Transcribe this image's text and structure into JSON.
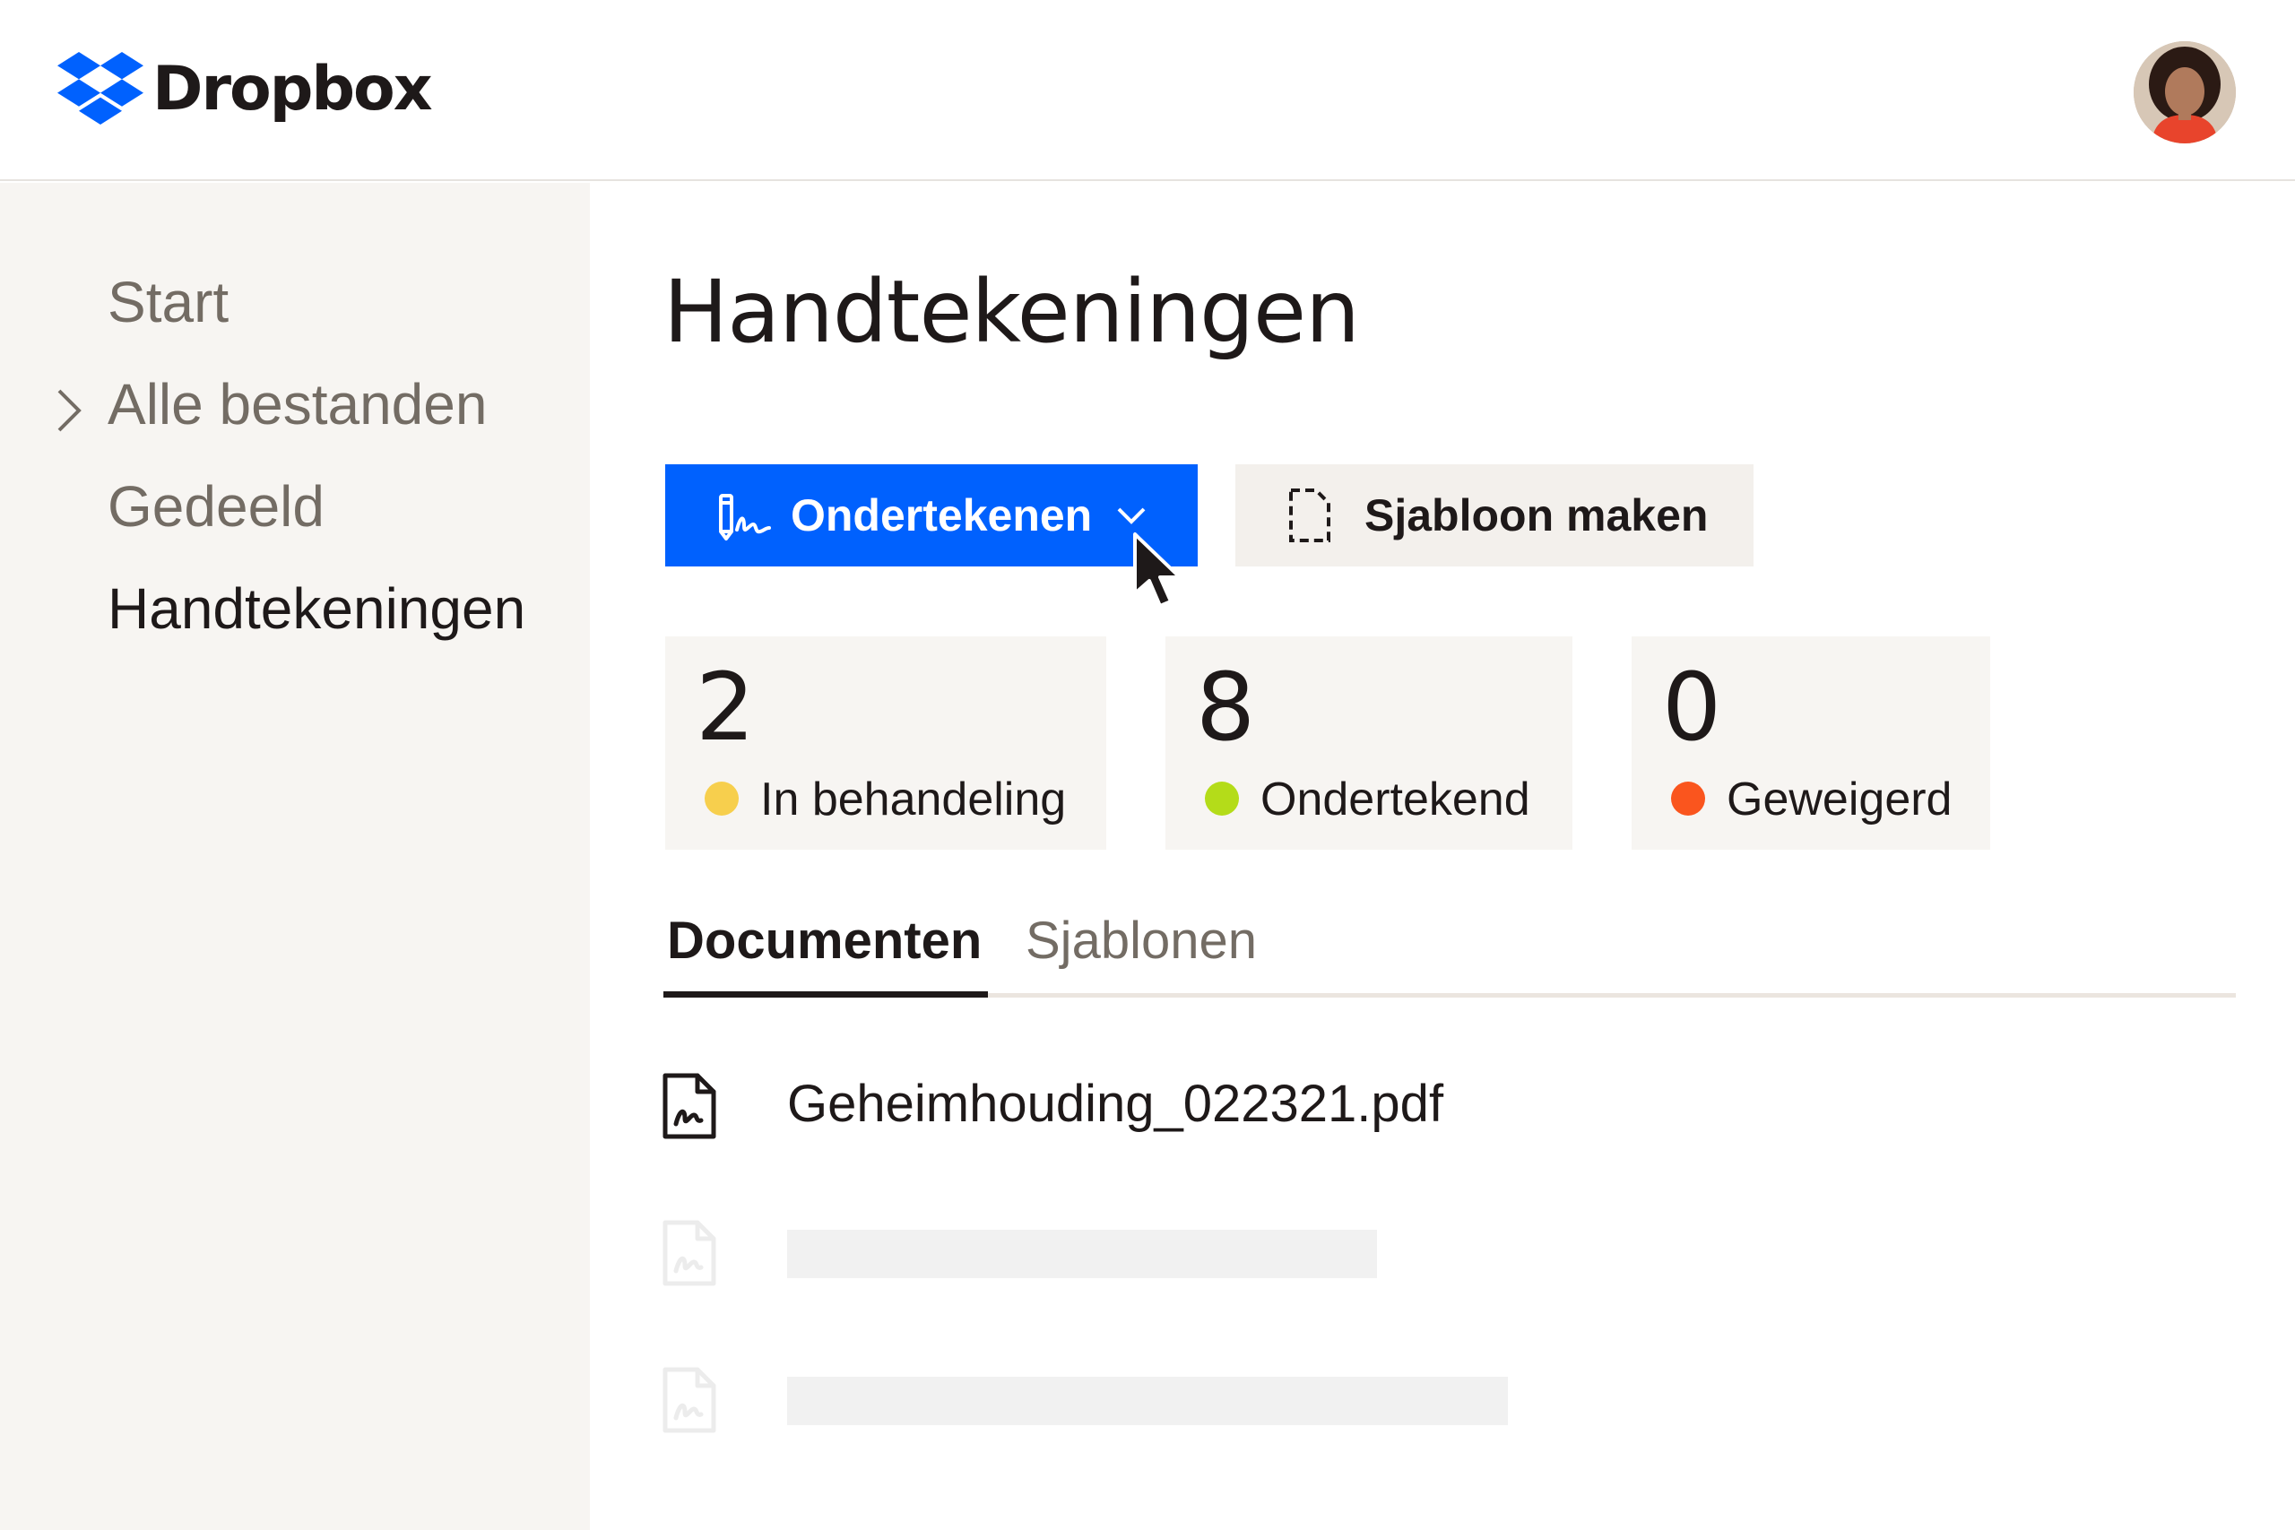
{
  "header": {
    "logo_text": "Dropbox",
    "logo_icon": "dropbox-logo-icon",
    "avatar_icon": "user-avatar"
  },
  "sidebar": {
    "items": [
      {
        "label": "Start"
      },
      {
        "label": "Alle bestanden",
        "expandable": true
      },
      {
        "label": "Gedeeld"
      },
      {
        "label": "Handtekeningen",
        "active": true
      }
    ]
  },
  "main": {
    "title": "Handtekeningen",
    "primary_button": {
      "label": "Ondertekenen",
      "icon": "signature-pen-icon",
      "dropdown_icon": "chevron-down-icon"
    },
    "secondary_button": {
      "label": "Sjabloon maken",
      "icon": "template-document-icon"
    },
    "stats": [
      {
        "count": "2",
        "label": "In behandeling",
        "color": "#f7cf4d"
      },
      {
        "count": "8",
        "label": "Ondertekend",
        "color": "#b4dc19"
      },
      {
        "count": "0",
        "label": "Geweigerd",
        "color": "#fa551e"
      }
    ],
    "tabs": [
      {
        "label": "Documenten",
        "active": true
      },
      {
        "label": "Sjablonen",
        "active": false
      }
    ],
    "files": [
      {
        "name": "Geheimhouding_022321.pdf",
        "icon": "signed-document-icon"
      }
    ]
  },
  "colors": {
    "accent": "#0061fe",
    "sidebar_bg": "#f7f5f2",
    "text": "#1e1919",
    "muted_text": "#736c64"
  }
}
